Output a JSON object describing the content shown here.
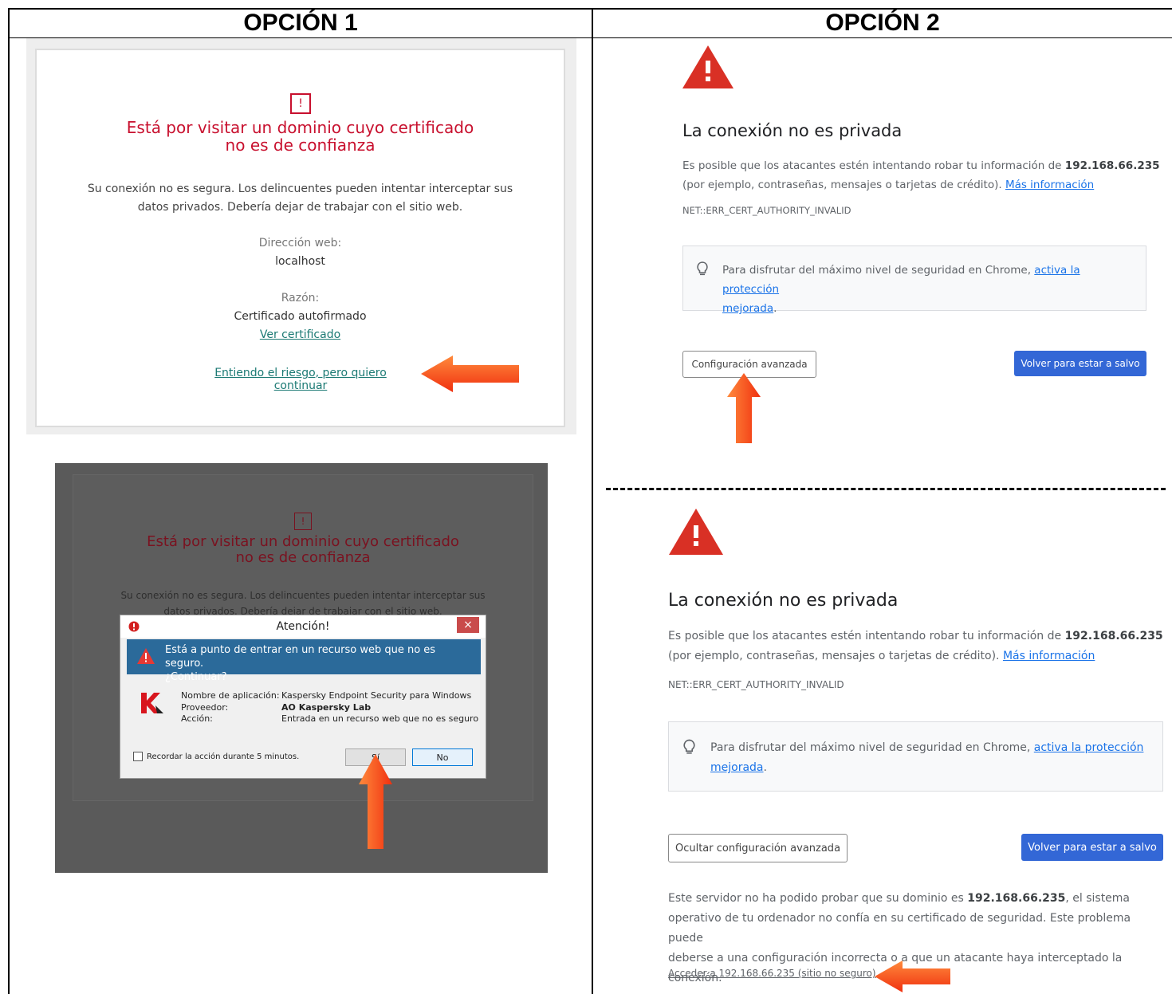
{
  "headers": {
    "option1": "OPCIÓN 1",
    "option2": "OPCIÓN 2"
  },
  "kaspersky_page": {
    "icon": "exclamation-icon",
    "warning_mark": "!",
    "title_line1": "Está por visitar un dominio cuyo certificado",
    "title_line2": "no es de confianza",
    "body_line1": "Su conexión no es segura. Los delincuentes pueden intentar interceptar sus",
    "body_line2": "datos privados. Debería dejar de trabajar con el sitio web.",
    "web_address_label": "Dirección web:",
    "web_address_value": "localhost",
    "reason_label": "Razón:",
    "reason_value": "Certificado autofirmado",
    "view_certificate_link": "Ver certificado",
    "continue_link": "Entiendo el riesgo, pero quiero continuar"
  },
  "kaspersky_dialog_page": {
    "warning_mark": "!",
    "bg_title_line1": "Está por visitar un dominio cuyo certificado",
    "bg_title_line2": "no es de confianza",
    "bg_body_line1": "Su conexión no es segura. Los delincuentes pueden intentar interceptar sus",
    "bg_body_line2": "datos privados. Debería dejar de trabajar con el sitio web.",
    "dialog": {
      "title": "Atención!",
      "close": "×",
      "banner_line1": "Está a punto de entrar en un recurso web que no es seguro.",
      "banner_line2": "¿Continuar?",
      "app_name_label": "Nombre de aplicación:",
      "app_name_value": "Kaspersky Endpoint Security para Windows",
      "provider_label": "Proveedor:",
      "provider_value": "AO Kaspersky Lab",
      "action_label": "Acción:",
      "action_value": "Entrada en un recurso web que no es seguro",
      "remember_label": "Recordar la acción durante 5 minutos.",
      "yes_button": "Sí",
      "no_button": "No"
    }
  },
  "chrome_top": {
    "title": "La conexión no es privada",
    "body_pre": "Es posible que los atacantes estén intentando robar tu información de ",
    "host": "192.168.66.235",
    "body_post": "(por ejemplo, contraseñas, mensajes o tarjetas de crédito). ",
    "more_info_link": "Más información",
    "error_code": "NET::ERR_CERT_AUTHORITY_INVALID",
    "tip_pre": "Para disfrutar del máximo nivel de seguridad en Chrome, ",
    "tip_link1": "activa la protección",
    "tip_link2": "mejorada",
    "tip_end": ".",
    "advanced_button": "Configuración avanzada",
    "back_button": "Volver para estar a salvo"
  },
  "chrome_bottom": {
    "title": "La conexión no es privada",
    "body_pre": "Es posible que los atacantes estén intentando robar tu información de ",
    "host": "192.168.66.235",
    "body_post": "(por ejemplo, contraseñas, mensajes o tarjetas de crédito). ",
    "more_info_link": "Más información",
    "error_code": "NET::ERR_CERT_AUTHORITY_INVALID",
    "tip_pre": "Para disfrutar del máximo nivel de seguridad en Chrome, ",
    "tip_link1": "activa la protección",
    "tip_link2": "mejorada",
    "tip_end": ".",
    "hide_advanced_button": "Ocultar configuración avanzada",
    "back_button": "Volver para estar a salvo",
    "detail_pre": "Este servidor no ha podido probar que su dominio es ",
    "detail_host": "192.168.66.235",
    "detail_line1_post": ", el sistema",
    "detail_line2": "operativo de tu ordenador no confía en su certificado de seguridad. Este problema puede",
    "detail_line3": "deberse a una configuración incorrecta o a que un atacante haya interceptado la conexión.",
    "proceed_link": "Acceder a 192.168.66.235 (sitio no seguro)"
  },
  "colors": {
    "kaspersky_red": "#c8102e",
    "kaspersky_link": "#1c7a74",
    "chrome_red": "#d93025",
    "chrome_blue": "#3367d6",
    "arrow_orange": "#ff5a1f"
  }
}
